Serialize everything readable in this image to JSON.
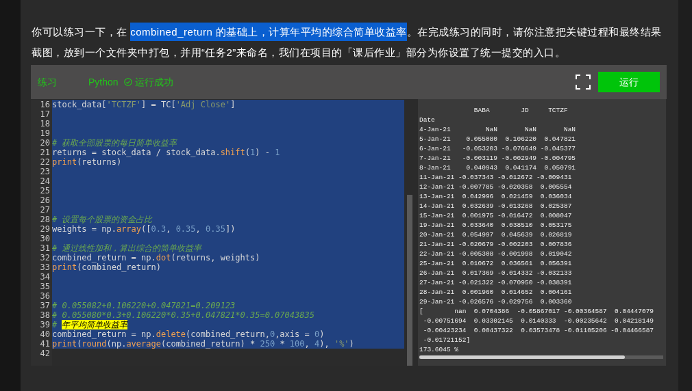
{
  "paragraph": [
    {
      "text": "你可以练习一下，在 ",
      "highlighted": false
    },
    {
      "text": "combined_return 的基础上，计算年平均的综合简单收益率",
      "highlighted": true
    },
    {
      "text": "。在完成练习的同时，请你注意把关键过程和最终结果截图，放到一个文件夹中打包，并用“任务2”来命名，我们在项目的「课后作业」部分为你设置了统一提交的入口。",
      "highlighted": false
    }
  ],
  "editor": {
    "tab": "练习",
    "language": "Python",
    "status": "运行成功",
    "run_button": "运行",
    "lines": [
      {
        "number": "16",
        "tokens": [
          {
            "t": "stock_data[",
            "kind": "plain"
          },
          {
            "t": "'TCTZF'",
            "kind": "string"
          },
          {
            "t": "] = TC[",
            "kind": "plain"
          },
          {
            "t": "'Adj Close'",
            "kind": "string"
          },
          {
            "t": "]",
            "kind": "plain"
          }
        ]
      },
      {
        "number": "17"
      },
      {
        "number": "18"
      },
      {
        "number": "19"
      },
      {
        "number": "20",
        "tokens": [
          {
            "t": "# 获取全部股票的每日简单收益率",
            "kind": "comment"
          }
        ]
      },
      {
        "number": "21",
        "tokens": [
          {
            "t": "returns = stock_data / stock_data.",
            "kind": "plain"
          },
          {
            "t": "shift",
            "kind": "func"
          },
          {
            "t": "(",
            "kind": "plain"
          },
          {
            "t": "1",
            "kind": "number"
          },
          {
            "t": ") - ",
            "kind": "plain"
          },
          {
            "t": "1",
            "kind": "number"
          }
        ]
      },
      {
        "number": "22",
        "tokens": [
          {
            "t": "print",
            "kind": "func"
          },
          {
            "t": "(returns)",
            "kind": "plain"
          }
        ]
      },
      {
        "number": "23"
      },
      {
        "number": "24"
      },
      {
        "number": "25"
      },
      {
        "number": "26"
      },
      {
        "number": "27"
      },
      {
        "number": "28",
        "tokens": [
          {
            "t": "# 设置每个股票的资金占比",
            "kind": "comment"
          }
        ]
      },
      {
        "number": "29",
        "tokens": [
          {
            "t": "weights = np.",
            "kind": "plain"
          },
          {
            "t": "array",
            "kind": "func"
          },
          {
            "t": "([",
            "kind": "plain"
          },
          {
            "t": "0.3",
            "kind": "number"
          },
          {
            "t": ", ",
            "kind": "plain"
          },
          {
            "t": "0.35",
            "kind": "number"
          },
          {
            "t": ", ",
            "kind": "plain"
          },
          {
            "t": "0.35",
            "kind": "number"
          },
          {
            "t": "])",
            "kind": "plain"
          }
        ]
      },
      {
        "number": "30"
      },
      {
        "number": "31",
        "tokens": [
          {
            "t": "# 通过线性加和，算出综合的简单收益率",
            "kind": "comment"
          }
        ]
      },
      {
        "number": "32",
        "tokens": [
          {
            "t": "combined_return = np.",
            "kind": "plain"
          },
          {
            "t": "dot",
            "kind": "func"
          },
          {
            "t": "(returns, weights)",
            "kind": "plain"
          }
        ]
      },
      {
        "number": "33",
        "tokens": [
          {
            "t": "print",
            "kind": "func"
          },
          {
            "t": "(combined_return)",
            "kind": "plain"
          }
        ]
      },
      {
        "number": "34"
      },
      {
        "number": "35"
      },
      {
        "number": "36"
      },
      {
        "number": "37",
        "tokens": [
          {
            "t": "# 0.055082+0.106220+0.047821=0.209123",
            "kind": "comment"
          }
        ]
      },
      {
        "number": "38",
        "tokens": [
          {
            "t": "# 0.055080*0.3+0.106220*0.35+0.047821*0.35=0.07043835",
            "kind": "comment"
          }
        ]
      },
      {
        "number": "39",
        "tokens": [
          {
            "t": "# ",
            "kind": "comment"
          },
          {
            "t": "年平均简单收益率",
            "kind": "marked"
          }
        ]
      },
      {
        "number": "40",
        "tokens": [
          {
            "t": "combined_return = np.",
            "kind": "plain"
          },
          {
            "t": "delete",
            "kind": "func"
          },
          {
            "t": "(combined_return,",
            "kind": "plain"
          },
          {
            "t": "0",
            "kind": "number"
          },
          {
            "t": ",axis = ",
            "kind": "plain"
          },
          {
            "t": "0",
            "kind": "number"
          },
          {
            "t": ")",
            "kind": "plain"
          }
        ]
      },
      {
        "number": "41",
        "tokens": [
          {
            "t": "print",
            "kind": "func"
          },
          {
            "t": "(",
            "kind": "plain"
          },
          {
            "t": "round",
            "kind": "func"
          },
          {
            "t": "(np.",
            "kind": "plain"
          },
          {
            "t": "average",
            "kind": "func"
          },
          {
            "t": "(combined_return) * ",
            "kind": "plain"
          },
          {
            "t": "250",
            "kind": "number"
          },
          {
            "t": " * ",
            "kind": "plain"
          },
          {
            "t": "100",
            "kind": "number"
          },
          {
            "t": ", ",
            "kind": "plain"
          },
          {
            "t": "4",
            "kind": "number"
          },
          {
            "t": "), ",
            "kind": "plain"
          },
          {
            "t": "'%'",
            "kind": "string"
          },
          {
            "t": ")",
            "kind": "plain"
          }
        ]
      },
      {
        "number": "42"
      }
    ],
    "output": [
      "              BABA        JD     TCTZF",
      "Date",
      "4-Jan-21         NaN       NaN       NaN",
      "5-Jan-21    0.055080  0.106220  0.047821",
      "6-Jan-21   -0.053203 -0.076649 -0.045377",
      "7-Jan-21   -0.003119 -0.002949 -0.004795",
      "8-Jan-21    0.040943  0.041174  0.050791",
      "11-Jan-21 -0.037343 -0.012672 -0.009431",
      "12-Jan-21 -0.007785 -0.020358  0.005554",
      "13-Jan-21  0.042996  0.021459  0.036034",
      "14-Jan-21  0.032639 -0.013268  0.025387",
      "15-Jan-21  0.001975 -0.016472  0.008047",
      "19-Jan-21  0.033640  0.038510  0.053175",
      "20-Jan-21  0.054997  0.045639  0.026819",
      "21-Jan-21 -0.020679 -0.002203  0.007836",
      "22-Jan-21 -0.005308 -0.001998  0.019042",
      "25-Jan-21  0.010672  0.036561  0.056391",
      "26-Jan-21  0.017369 -0.014332 -0.032133",
      "27-Jan-21 -0.021322 -0.070950 -0.038391",
      "28-Jan-21  0.001960  0.014652  0.004161",
      "29-Jan-21 -0.026576 -0.029756  0.003360",
      "[        nan  0.0704386  -0.05867017 -0.00364587  0.04447079",
      " -0.00751694  0.03302145  0.0140333  -0.00235642  0.04218149",
      " -0.00423234  0.00437322  0.03573478 -0.01105206 -0.04466587",
      " -0.01721152]",
      "173.6045 %"
    ]
  }
}
